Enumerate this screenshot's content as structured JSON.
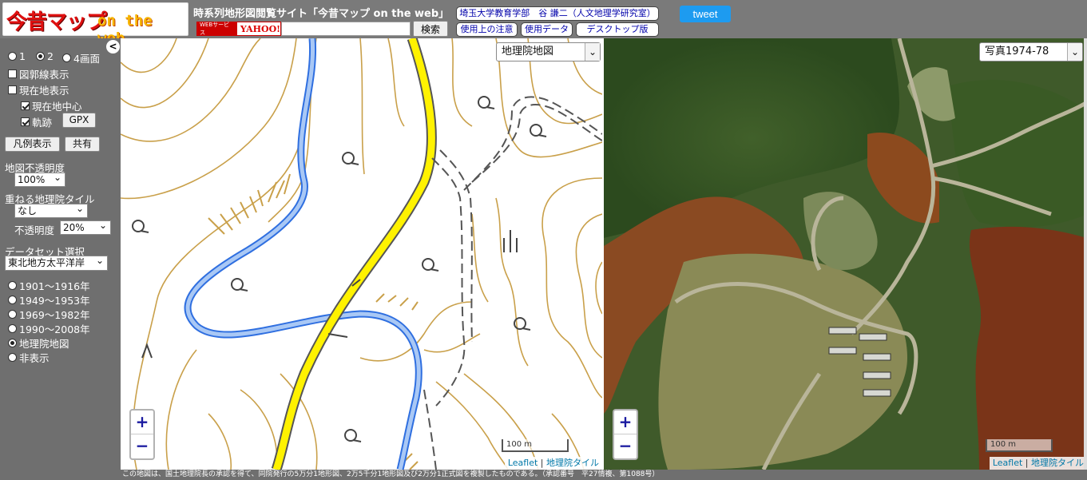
{
  "header": {
    "logo_main": "今昔マップ",
    "logo_sub": "on the web",
    "site_title": "時系列地形図閲覧サイト「今昔マップ on the web」",
    "yahoo_web": "WEBサービス",
    "yahoo_name": "YAHOO!",
    "search_value": "",
    "search_button": "検索",
    "author_link": "埼玉大学教育学部　谷 謙二（人文地理学研究室）",
    "notice_link": "使用上の注意",
    "data_link": "使用データ",
    "desktop_link": "デスクトップ版",
    "tweet": "tweet"
  },
  "sidebar": {
    "collapse": "<",
    "layout_options": [
      {
        "label": "1",
        "selected": false
      },
      {
        "label": "2",
        "selected": true
      },
      {
        "label": "4画面",
        "selected": false
      }
    ],
    "show_grid": "図郭線表示",
    "show_location": "現在地表示",
    "center_location": "現在地中心",
    "track": "軌跡",
    "gpx_button": "GPX",
    "legend_button": "凡例表示",
    "share_button": "共有",
    "opacity_label": "地図不透明度",
    "opacity_value": "100%",
    "overlay_label": "重ねる地理院タイル",
    "overlay_value": "なし",
    "overlay_opacity_label": "不透明度",
    "overlay_opacity_value": "20%",
    "dataset_label": "データセット選択",
    "dataset_value": "東北地方太平洋岸",
    "periods": [
      {
        "label": "1901～1916年",
        "selected": false
      },
      {
        "label": "1949～1953年",
        "selected": false
      },
      {
        "label": "1969～1982年",
        "selected": false
      },
      {
        "label": "1990～2008年",
        "selected": false
      },
      {
        "label": "地理院地図",
        "selected": true
      },
      {
        "label": "非表示",
        "selected": false
      }
    ]
  },
  "map_left": {
    "layer": "地理院地図",
    "zoom_in": "+",
    "zoom_out": "−",
    "scale": "100 m",
    "attrib_leaflet": "Leaflet",
    "attrib_sep": "|",
    "attrib_gsi": "地理院タイル"
  },
  "map_right": {
    "layer": "写真1974-78",
    "zoom_in": "+",
    "zoom_out": "−",
    "scale": "100 m",
    "attrib_leaflet": "Leaflet",
    "attrib_sep": "|",
    "attrib_gsi": "地理院タイル"
  },
  "footer": {
    "text": "この地図は、国土地理院長の承認を得て、同院発行の5万分1地形図、2万5千分1地形図及び2万分1正式図を複製したものである。（承認番号　平27情複、第1088号）"
  },
  "colors": {
    "contour": "#c9a04a",
    "road": "#fff200",
    "river": "#2f6fe0",
    "river_fill": "#a9c8f5"
  }
}
